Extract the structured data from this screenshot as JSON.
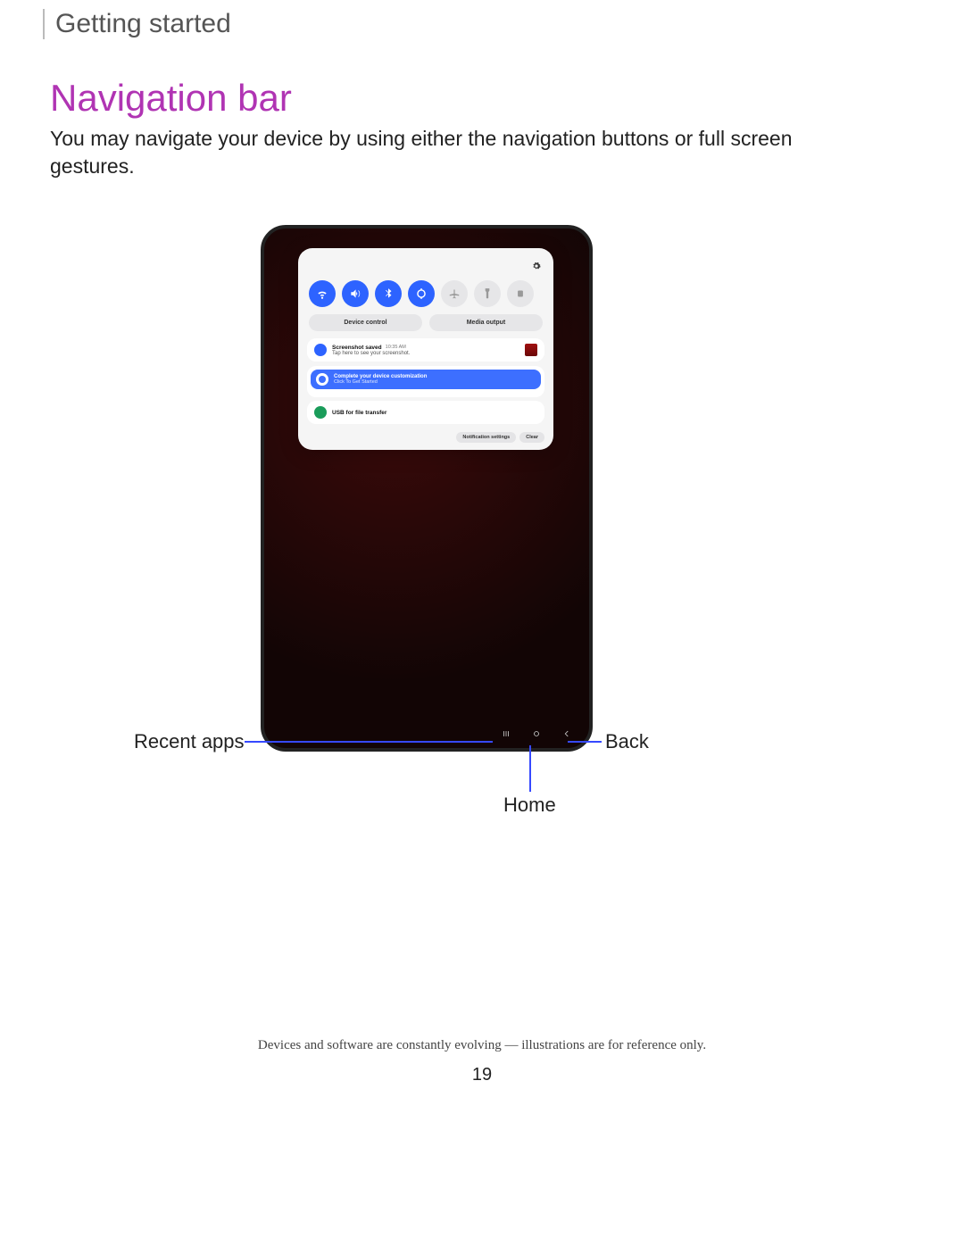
{
  "section": "Getting started",
  "title": "Navigation bar",
  "intro": "You may navigate your device by using either the navigation buttons or full screen gestures.",
  "callouts": {
    "recent": "Recent apps",
    "home": "Home",
    "back": "Back"
  },
  "panel": {
    "device_control": "Device control",
    "media_output": "Media output",
    "notif1_title": "Screenshot saved",
    "notif1_time": "10:35 AM",
    "notif1_sub": "Tap here to see your screenshot.",
    "notif2_title": "Complete your device customization",
    "notif2_sub": "Click To Get Started",
    "notif3_title": "USB for file transfer",
    "footer_settings": "Notification settings",
    "footer_clear": "Clear"
  },
  "disclaimer": "Devices and software are constantly evolving — illustrations are for reference only.",
  "page_number": "19"
}
